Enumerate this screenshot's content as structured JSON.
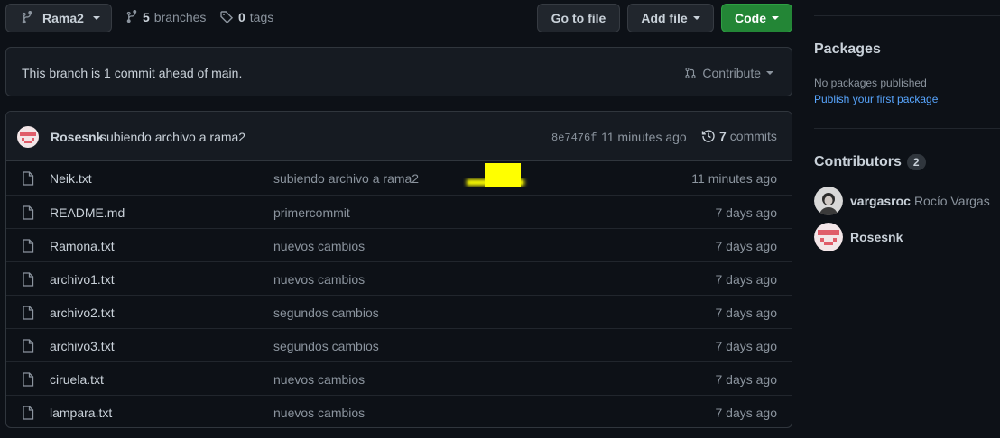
{
  "branch": {
    "name": "Rama2"
  },
  "branches": {
    "count": "5",
    "label": "branches"
  },
  "tags": {
    "count": "0",
    "label": "tags"
  },
  "actions": {
    "goto_file": "Go to file",
    "add_file": "Add file",
    "code": "Code"
  },
  "ahead_banner": {
    "text": "This branch is 1 commit ahead of main.",
    "contribute": "Contribute"
  },
  "latest_commit": {
    "author": "Rosesnk",
    "message": "subiendo archivo a rama2",
    "sha": "8e7476f",
    "time": "11 minutes ago",
    "commits_count": "7",
    "commits_label": "commits"
  },
  "files": [
    {
      "name": "Neik.txt",
      "message": "subiendo archivo a rama2",
      "date": "11 minutes ago"
    },
    {
      "name": "README.md",
      "message": "primercommit",
      "date": "7 days ago"
    },
    {
      "name": "Ramona.txt",
      "message": "nuevos cambios",
      "date": "7 days ago"
    },
    {
      "name": "archivo1.txt",
      "message": "nuevos cambios",
      "date": "7 days ago"
    },
    {
      "name": "archivo2.txt",
      "message": "segundos cambios",
      "date": "7 days ago"
    },
    {
      "name": "archivo3.txt",
      "message": "segundos cambios",
      "date": "7 days ago"
    },
    {
      "name": "ciruela.txt",
      "message": "nuevos cambios",
      "date": "7 days ago"
    },
    {
      "name": "lampara.txt",
      "message": "nuevos cambios",
      "date": "7 days ago"
    }
  ],
  "sidebar": {
    "packages_title": "Packages",
    "packages_empty": "No packages published",
    "packages_link": "Publish your first package",
    "contributors_title": "Contributors",
    "contributors_count": "2",
    "contributors": [
      {
        "login": "vargasroc",
        "name": "Rocío Vargas",
        "avatar": "photo-avatar"
      },
      {
        "login": "Rosesnk",
        "name": "",
        "avatar": "identicon-avatar"
      }
    ]
  },
  "colors": {
    "accent_link": "#58a6ff",
    "code_button": "#238636",
    "redaction": "#ffff00",
    "identicon": "#e05d6a"
  }
}
